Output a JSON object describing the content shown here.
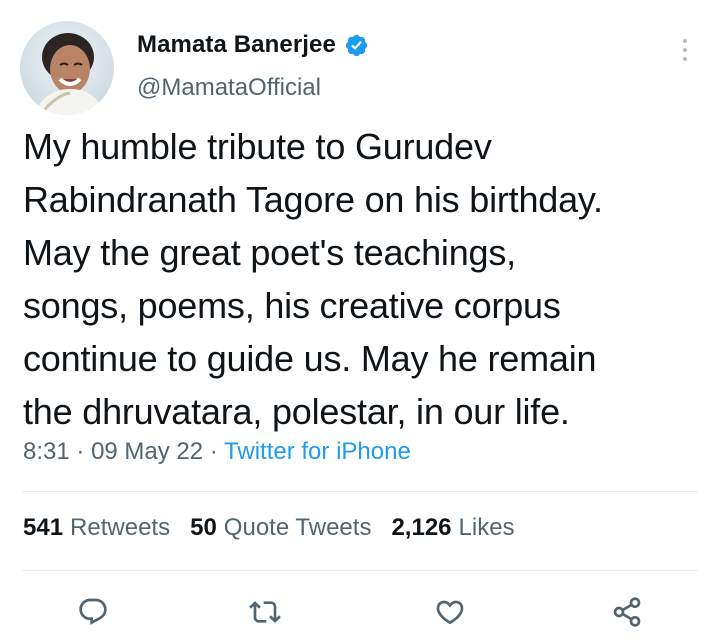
{
  "author": {
    "display_name": "Mamata Banerjee",
    "handle": "@MamataOfficial",
    "verified": true
  },
  "tweet": {
    "text": "My humble tribute to Gurudev\nRabindranath Tagore on his birthday.\nMay the great poet's teachings,\nsongs, poems, his creative corpus\ncontinue to guide us. May he remain\nthe dhruvatara, polestar, in our life.",
    "time": "8:31",
    "separator": "·",
    "date": "09 May 22",
    "source": "Twitter for iPhone"
  },
  "stats": [
    {
      "count": "541",
      "label": "Retweets"
    },
    {
      "count": "50",
      "label": "Quote Tweets"
    },
    {
      "count": "2,126",
      "label": "Likes"
    }
  ],
  "actions": [
    {
      "icon": "reply-icon"
    },
    {
      "icon": "retweet-icon"
    },
    {
      "icon": "like-icon"
    },
    {
      "icon": "share-icon"
    }
  ],
  "colors": {
    "text": "#0f1419",
    "secondary": "#536471",
    "accent": "#1d9bf0",
    "divider": "#e6ecf0"
  }
}
